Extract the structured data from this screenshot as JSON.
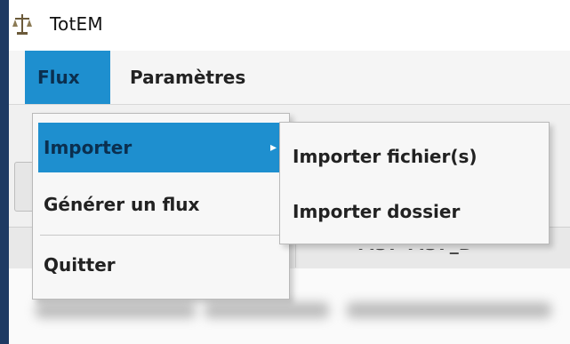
{
  "window": {
    "title": "TotEM",
    "app_icon": "scales-icon"
  },
  "menubar": {
    "items": [
      {
        "label": "Flux",
        "active": true
      },
      {
        "label": "Paramètres",
        "active": false
      }
    ]
  },
  "flux_menu": {
    "items": [
      {
        "label": "Importer",
        "has_submenu": true,
        "highlighted": true
      },
      {
        "label": "Générer un flux",
        "has_submenu": false
      },
      {
        "label": "Quitter",
        "has_submenu": false
      }
    ]
  },
  "importer_submenu": {
    "items": [
      {
        "label": "Importer fichier(s)"
      },
      {
        "label": "Importer dossier"
      }
    ]
  },
  "table": {
    "header_partial": "M37-M37_D"
  },
  "colors": {
    "frame": "#1e3a63",
    "highlight": "#1e8fcf",
    "menu_bg": "#f7f7f7"
  }
}
